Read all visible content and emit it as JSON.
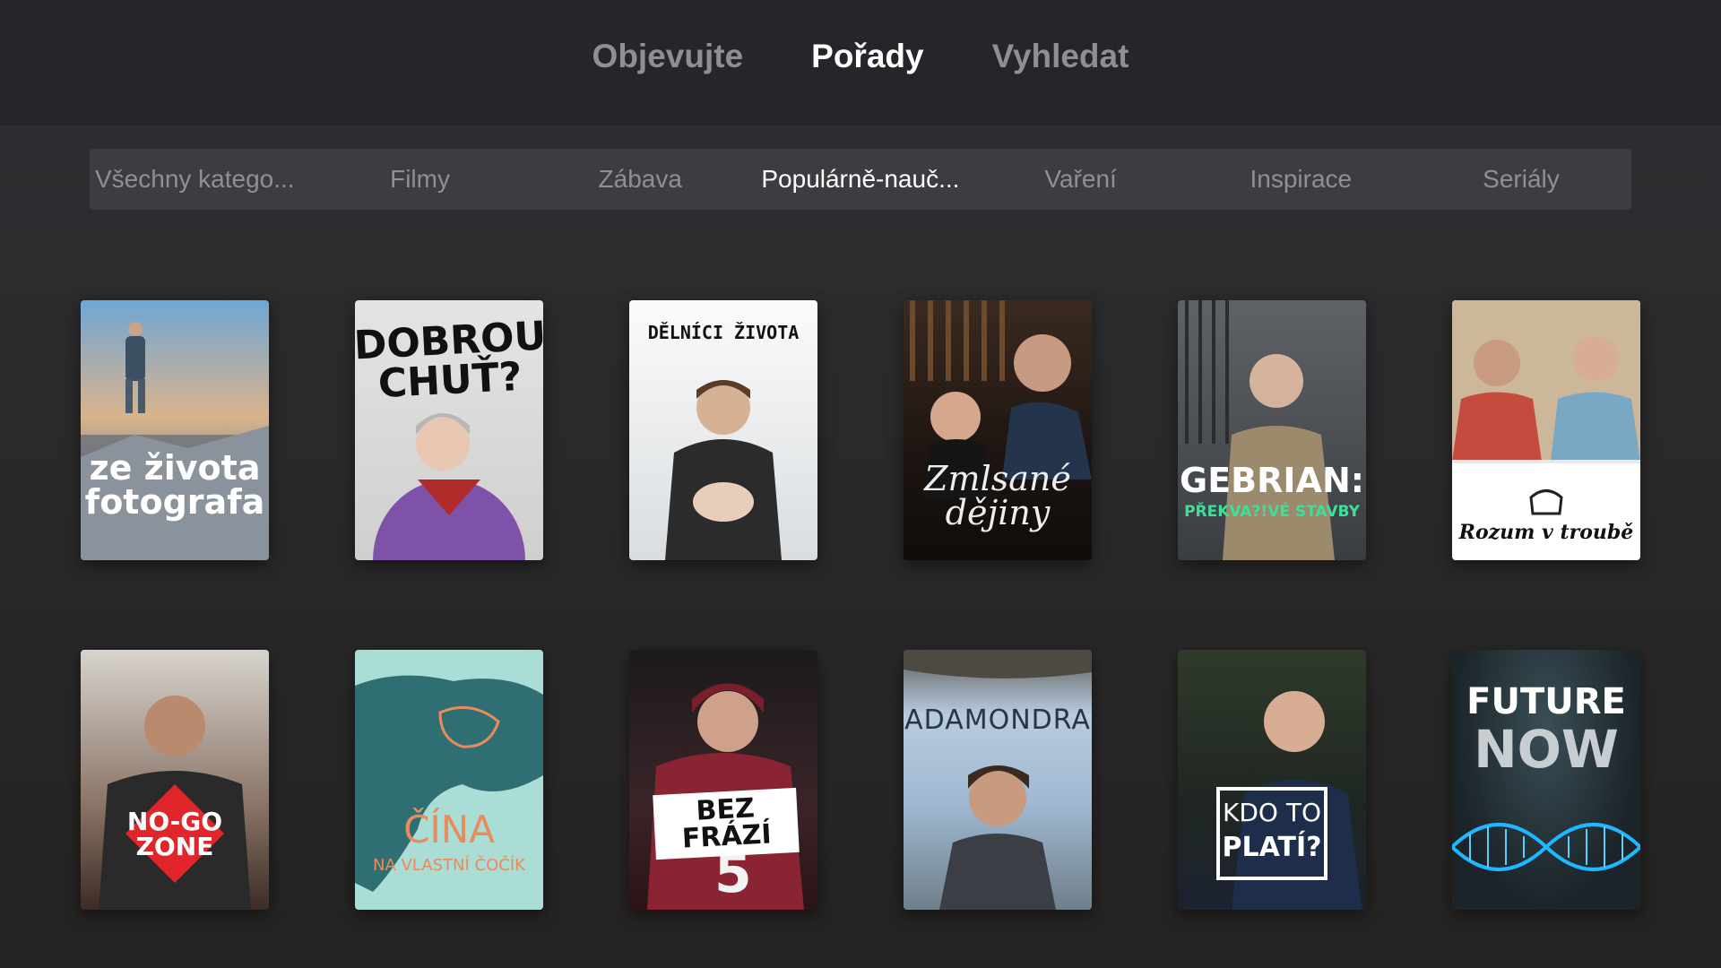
{
  "top_nav": {
    "tabs": [
      {
        "label": "Objevujte",
        "active": false
      },
      {
        "label": "Pořady",
        "active": true
      },
      {
        "label": "Vyhledat",
        "active": false
      }
    ]
  },
  "categories": [
    {
      "label": "Všechny katego...",
      "active": false
    },
    {
      "label": "Filmy",
      "active": false
    },
    {
      "label": "Zábava",
      "active": false
    },
    {
      "label": "Populárně-nauč...",
      "active": true
    },
    {
      "label": "Vaření",
      "active": false
    },
    {
      "label": "Inspirace",
      "active": false
    },
    {
      "label": "Seriály",
      "active": false
    }
  ],
  "shows": [
    {
      "poster_text": "ze života fotografa"
    },
    {
      "poster_text": "DOBROU CHUŤ?"
    },
    {
      "poster_text": "DĚLNÍCI ŽIVOTA"
    },
    {
      "poster_text": "Zmlsané dějiny"
    },
    {
      "poster_text": "GEBRIAN:",
      "poster_subtext": "PŘEKVA?!VÉ STAVBY"
    },
    {
      "poster_text": "Rozum v troubě"
    },
    {
      "poster_text": "NO-GO ZONE"
    },
    {
      "poster_text": "ČÍNA",
      "poster_subtext": "NA VLASTNÍ ČOČÍK"
    },
    {
      "poster_text": "BEZ FRÁZÍ"
    },
    {
      "poster_text": "ADAMONDRA"
    },
    {
      "poster_text": "KDO TO",
      "poster_subtext": "PLATÍ?"
    },
    {
      "poster_text": "FUTURE",
      "poster_subtext": "NOW"
    }
  ],
  "colors": {
    "topbar": "#24262a",
    "category_bar": "#3c3d40",
    "active_text": "#ffffff",
    "inactive_text": "#8e9094"
  }
}
